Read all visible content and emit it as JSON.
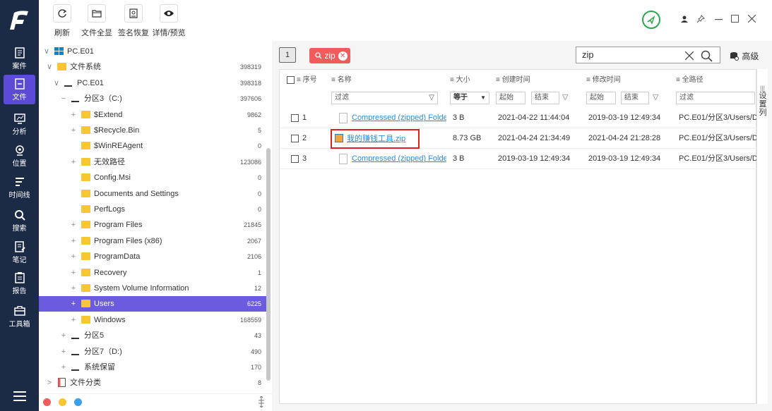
{
  "nav": {
    "items": [
      {
        "label": "案件",
        "icon": "case-icon"
      },
      {
        "label": "文件",
        "icon": "file-icon",
        "active": true
      },
      {
        "label": "分析",
        "icon": "analysis-icon"
      },
      {
        "label": "位置",
        "icon": "location-icon"
      },
      {
        "label": "时间线",
        "icon": "timeline-icon"
      },
      {
        "label": "搜索",
        "icon": "search-icon"
      },
      {
        "label": "笔记",
        "icon": "note-icon"
      },
      {
        "label": "报告",
        "icon": "report-icon"
      },
      {
        "label": "工具箱",
        "icon": "toolbox-icon"
      }
    ]
  },
  "toolbar": {
    "refresh": "刷新",
    "file_overview": "文件全显",
    "sig_restore": "签名恢复",
    "details": "详情/预览"
  },
  "tree": {
    "rows": [
      {
        "exp": "∨",
        "label": "PC.E01",
        "count": "",
        "icon": "windows",
        "selected": false
      },
      {
        "exp": "∨",
        "label": "文件系统",
        "count": "398319",
        "icon": "folder",
        "selected": false
      },
      {
        "exp": "∨",
        "label": "PC.E01",
        "count": "398318",
        "icon": "drive",
        "selected": false
      },
      {
        "exp": "−",
        "label": "分区3（C:)",
        "count": "397606",
        "icon": "drive",
        "selected": false
      },
      {
        "exp": "+",
        "label": "$Extend",
        "count": "9862",
        "icon": "folder",
        "selected": false
      },
      {
        "exp": "+",
        "label": "$Recycle.Bin",
        "count": "5",
        "icon": "folder",
        "selected": false
      },
      {
        "exp": "",
        "label": "$WinREAgent",
        "count": "0",
        "icon": "folder",
        "selected": false
      },
      {
        "exp": "+",
        "label": "无效路径",
        "count": "123086",
        "icon": "folder",
        "selected": false
      },
      {
        "exp": "",
        "label": "Config.Msi",
        "count": "0",
        "icon": "folder",
        "selected": false
      },
      {
        "exp": "",
        "label": "Documents and Settings",
        "count": "0",
        "icon": "folder",
        "selected": false
      },
      {
        "exp": "",
        "label": "PerfLogs",
        "count": "0",
        "icon": "folder",
        "selected": false
      },
      {
        "exp": "+",
        "label": "Program Files",
        "count": "21845",
        "icon": "folder",
        "selected": false
      },
      {
        "exp": "+",
        "label": "Program Files (x86)",
        "count": "2067",
        "icon": "folder",
        "selected": false
      },
      {
        "exp": "+",
        "label": "ProgramData",
        "count": "2106",
        "icon": "folder",
        "selected": false
      },
      {
        "exp": "+",
        "label": "Recovery",
        "count": "1",
        "icon": "folder",
        "selected": false
      },
      {
        "exp": "+",
        "label": "System Volume Information",
        "count": "12",
        "icon": "folder",
        "selected": false
      },
      {
        "exp": "+",
        "label": "Users",
        "count": "6225",
        "icon": "folder",
        "selected": true
      },
      {
        "exp": "+",
        "label": "Windows",
        "count": "168559",
        "icon": "folder",
        "selected": false
      },
      {
        "exp": "+",
        "label": "分区5",
        "count": "43",
        "icon": "drive",
        "selected": false
      },
      {
        "exp": "+",
        "label": "分区7（D:)",
        "count": "490",
        "icon": "drive",
        "selected": false
      },
      {
        "exp": "+",
        "label": "系统保留",
        "count": "170",
        "icon": "drive",
        "selected": false
      },
      {
        "exp": ">",
        "label": "文件分类",
        "count": "8",
        "icon": "doc",
        "selected": false
      }
    ]
  },
  "search": {
    "tab_number": "1",
    "tag_label": "zip",
    "query": "zip",
    "advanced": "高级"
  },
  "table": {
    "headers": {
      "index": "序号",
      "name": "名称",
      "size": "大小",
      "created": "创建时间",
      "modified": "修改时间",
      "path": "全路径"
    },
    "filters": {
      "name": "过滤",
      "size": "等于",
      "created_start": "起始",
      "created_end": "结束",
      "modified_start": "起始",
      "modified_end": "结束",
      "path": "过滤"
    },
    "side_label": "设置列",
    "rows": [
      {
        "index": "1",
        "name": "Compressed (zipped) Folder",
        "size": "3 B",
        "created": "2021-04-22 11:44:04",
        "modified": "2019-03-19 12:49:34",
        "path": "PC.E01/分区3/Users/D",
        "highlight": false
      },
      {
        "index": "2",
        "name": "我的赚钱工具.zip",
        "size": "8.73 GB",
        "created": "2021-04-24 21:34:49",
        "modified": "2021-04-24 21:28:28",
        "path": "PC.E01/分区3/Users/D",
        "highlight": true
      },
      {
        "index": "3",
        "name": "Compressed (zipped) Folder",
        "size": "3 B",
        "created": "2019-03-19 12:49:34",
        "modified": "2019-03-19 12:49:34",
        "path": "PC.E01/分区3/Users/D",
        "highlight": false
      }
    ]
  },
  "colors": {
    "nav_bg": "#1c2b45",
    "accent": "#5b4bd6",
    "tag_red": "#f15b5b",
    "link": "#2a8bd8",
    "highlight_border": "#e02020"
  }
}
